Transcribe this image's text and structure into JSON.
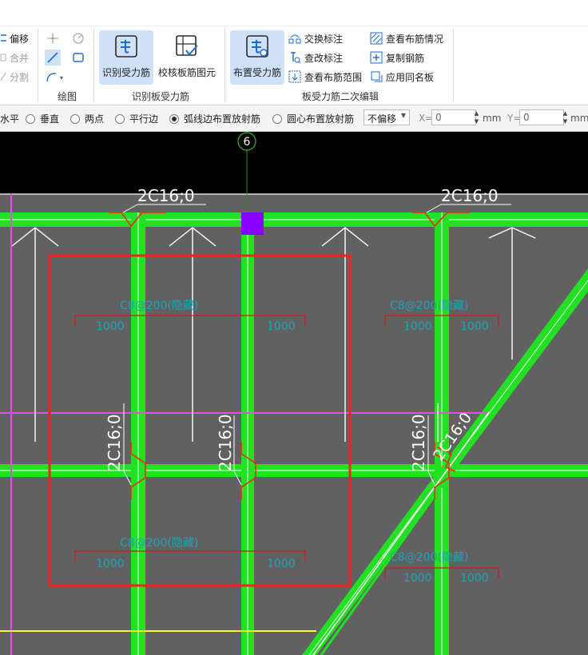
{
  "ribbon": {
    "modify_buttons": [
      "偏移",
      "合并",
      "分割"
    ],
    "draw_group_label": "绘图",
    "recognize": {
      "group_label": "识别板受力筋",
      "buttons": [
        "识别受力筋",
        "校核板筋图元"
      ]
    },
    "edit": {
      "group_label": "板受力筋二次编辑",
      "main_button": "布置受力筋",
      "col1": [
        "交换标注",
        "查改标注",
        "查看布筋范围"
      ],
      "col2": [
        "查看布筋情况",
        "复制钢筋",
        "应用同名板"
      ]
    }
  },
  "options": {
    "radios": [
      {
        "label": "水平",
        "checked": false
      },
      {
        "label": "垂直",
        "checked": false
      },
      {
        "label": "两点",
        "checked": false
      },
      {
        "label": "平行边",
        "checked": false
      },
      {
        "label": "弧线边布置放射筋",
        "checked": true
      },
      {
        "label": "圆心布置放射筋",
        "checked": false
      }
    ],
    "offset_select": "不偏移",
    "x_label": "X=",
    "x_value": "0",
    "y_label": "Y=",
    "y_value": "0",
    "unit": "mm"
  },
  "drawing": {
    "axis_label": "6",
    "rebar_labels": [
      "2C16;0",
      "2C16;0",
      "2C16;0",
      "2C16;0",
      "2C16;0",
      "2C16;0"
    ],
    "slab_labels": [
      "C8@200(隐藏)",
      "C8@200(隐藏)",
      "C8@200(隐藏)",
      "C8@200(隐藏)"
    ],
    "dimension_values": [
      "1000",
      "1000"
    ],
    "colors": {
      "background": "#616161",
      "beam": "#22e022",
      "selection": "#ff1e1e",
      "axis_magenta": "#e84ce8",
      "column_purple": "#8a00ff",
      "yellow_line": "#ffff33"
    }
  }
}
